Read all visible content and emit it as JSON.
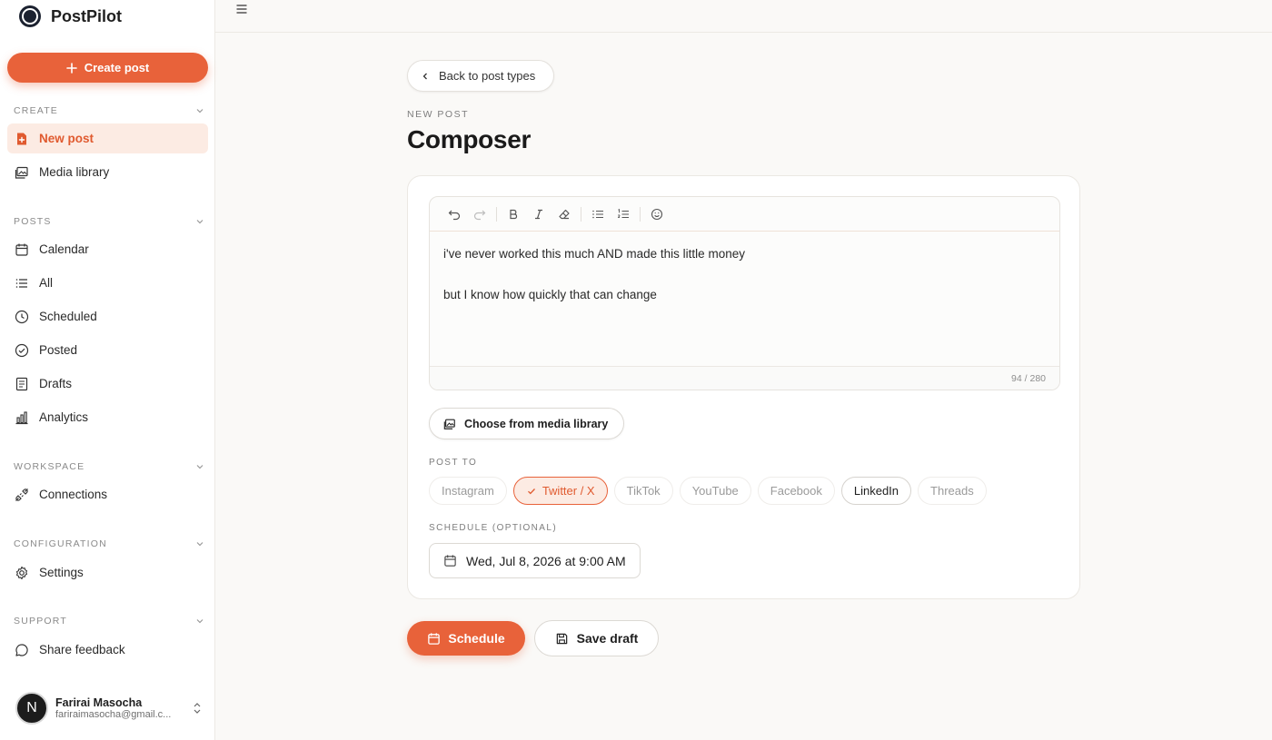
{
  "app": {
    "name": "PostPilot"
  },
  "sidebar": {
    "create_button": "Create post",
    "sections": {
      "create": "CREATE",
      "posts": "POSTS",
      "workspace": "WORKSPACE",
      "configuration": "CONFIGURATION",
      "support": "SUPPORT"
    },
    "items": {
      "new_post": "New post",
      "media_library": "Media library",
      "calendar": "Calendar",
      "all": "All",
      "scheduled": "Scheduled",
      "posted": "Posted",
      "drafts": "Drafts",
      "analytics": "Analytics",
      "connections": "Connections",
      "settings": "Settings",
      "share_feedback": "Share feedback"
    },
    "user": {
      "initial": "N",
      "name": "Farirai Masocha",
      "email": "fariraimasocha@gmail.c..."
    }
  },
  "main": {
    "back_button": "Back to post types",
    "eyebrow": "NEW POST",
    "title": "Composer",
    "editor": {
      "line1": "i've never worked this much AND made this little money",
      "line2": "but I know how quickly that can change",
      "char_count": "94 / 280"
    },
    "media_button": "Choose from media library",
    "post_to_label": "POST TO",
    "platforms": {
      "instagram": "Instagram",
      "twitter": "Twitter / X",
      "tiktok": "TikTok",
      "youtube": "YouTube",
      "facebook": "Facebook",
      "linkedin": "LinkedIn",
      "threads": "Threads"
    },
    "schedule_label": "SCHEDULE (OPTIONAL)",
    "schedule_value": "Wed, Jul 8, 2026 at 9:00 AM",
    "schedule_button": "Schedule",
    "save_draft_button": "Save draft"
  },
  "colors": {
    "accent": "#e8623a",
    "accent_soft": "#fcebe3",
    "background": "#faf9f7"
  }
}
